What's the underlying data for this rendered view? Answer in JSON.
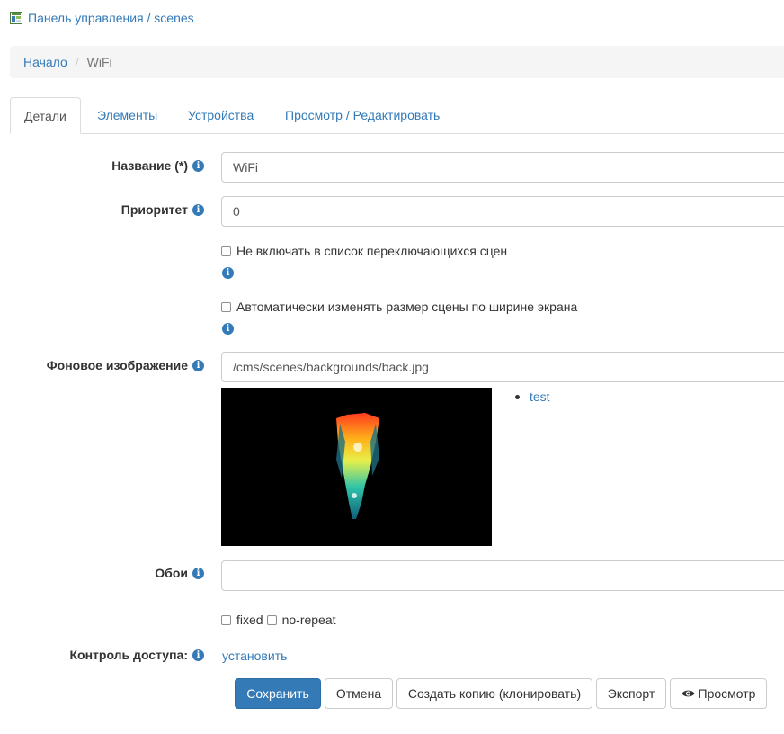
{
  "header": {
    "breadcrumb_link": "Панель управления / scenes",
    "icon": "page-icon"
  },
  "breadcrumb": {
    "home": "Начало",
    "separator": "/",
    "current": "WiFi"
  },
  "tabs": [
    {
      "label": "Детали",
      "active": true
    },
    {
      "label": "Элементы",
      "active": false
    },
    {
      "label": "Устройства",
      "active": false
    },
    {
      "label": "Просмотр / Редактировать",
      "active": false
    }
  ],
  "form": {
    "name_label": "Название (*)",
    "name_value": "WiFi",
    "priority_label": "Приоритет",
    "priority_value": "0",
    "exclude_switching_label": "Не включать в список переключающихся сцен",
    "exclude_switching_checked": false,
    "auto_resize_label": "Автоматически изменять размер сцены по ширине экрана",
    "auto_resize_checked": false,
    "background_label": "Фоновое изображение",
    "background_value": "/cms/scenes/backgrounds/back.jpg",
    "background_options": [
      "test"
    ],
    "wallpaper_label": "Обои",
    "wallpaper_value": "",
    "fixed_label": "fixed",
    "fixed_checked": false,
    "norepeat_label": "no-repeat",
    "norepeat_checked": false,
    "access_label": "Контроль доступа:",
    "access_link": "установить"
  },
  "buttons": {
    "save": "Сохранить",
    "cancel": "Отмена",
    "clone": "Создать копию (клонировать)",
    "export": "Экспорт",
    "preview": "Просмотр"
  },
  "icons": {
    "info": "info-icon",
    "eye": "eye-icon",
    "checkbox": "checkbox"
  },
  "colors": {
    "accent": "#337ab7",
    "breadcrumb_bg": "#f5f5f5",
    "border": "#cccccc"
  }
}
